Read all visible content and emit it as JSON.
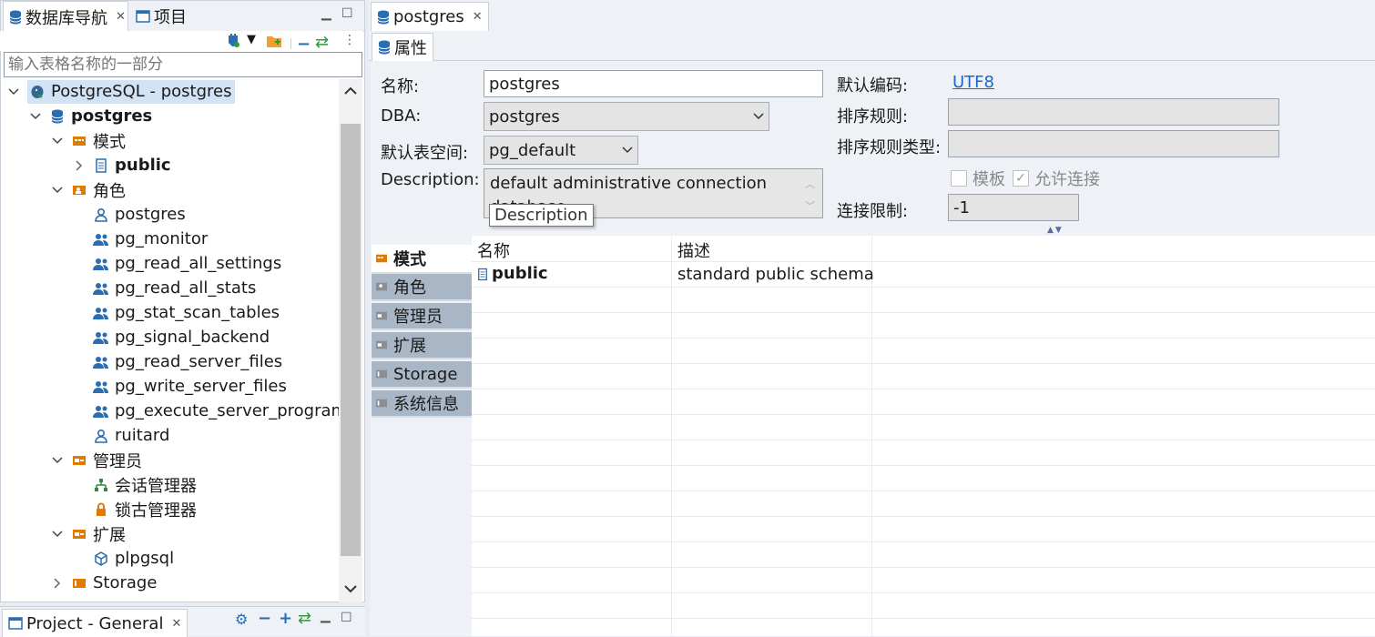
{
  "left_panel": {
    "tab_db_nav": "数据库导航",
    "tab_project": "项目",
    "filter_placeholder": "输入表格名称的一部分",
    "tree": {
      "connection": "PostgreSQL - postgres",
      "database": "postgres",
      "schemas_folder": "模式",
      "schema_public": "public",
      "roles_folder": "角色",
      "roles": [
        "postgres",
        "pg_monitor",
        "pg_read_all_settings",
        "pg_read_all_stats",
        "pg_stat_scan_tables",
        "pg_signal_backend",
        "pg_read_server_files",
        "pg_write_server_files",
        "pg_execute_server_program",
        "ruitard"
      ],
      "admin_folder": "管理员",
      "admin_items": [
        "会话管理器",
        "锁古管理器"
      ],
      "ext_folder": "扩展",
      "ext_items": [
        "plpgsql"
      ],
      "storage_folder": "Storage"
    }
  },
  "bottom_panel": {
    "tab": "Project - General"
  },
  "editor": {
    "tab_title": "postgres",
    "subtab": "属性",
    "props": {
      "name_label": "名称:",
      "name_value": "postgres",
      "dba_label": "DBA:",
      "dba_value": "postgres",
      "tablespace_label": "默认表空间:",
      "tablespace_value": "pg_default",
      "desc_label": "Description:",
      "desc_value": "default administrative connection database",
      "tooltip": "Description",
      "encoding_label": "默认编码:",
      "encoding_value": "UTF8",
      "collation_label": "排序规则:",
      "collation_type_label": "排序规则类型:",
      "template_label": "模板",
      "allow_conn_label": "允许连接",
      "conn_limit_label": "连接限制:",
      "conn_limit_value": "-1"
    },
    "vtabs": [
      "模式",
      "角色",
      "管理员",
      "扩展",
      "Storage",
      "系统信息"
    ],
    "table": {
      "col_name": "名称",
      "col_desc": "描述",
      "rows": [
        {
          "name": "public",
          "desc": "standard public schema"
        }
      ]
    },
    "colors": {
      "link": "#1a66c9",
      "accent": "#2a6db0",
      "folder": "#e07b00"
    }
  }
}
